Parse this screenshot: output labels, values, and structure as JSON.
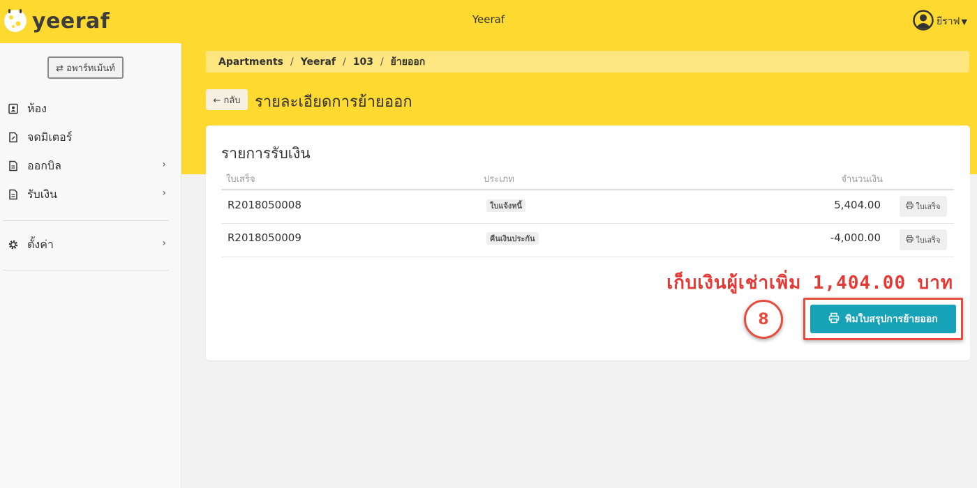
{
  "header": {
    "logo_text": "yeeraf",
    "app_title": "Yeeraf",
    "user_name": "ยีราฟ"
  },
  "sidebar": {
    "apartment_switch_label": "⇄ อพาร์ทเม้นท์",
    "items": [
      {
        "label": "ห้อง",
        "icon": "contact-card-icon",
        "has_submenu": false
      },
      {
        "label": "จดมิเตอร์",
        "icon": "edit-document-icon",
        "has_submenu": false
      },
      {
        "label": "ออกบิล",
        "icon": "document-icon",
        "has_submenu": true
      },
      {
        "label": "รับเงิน",
        "icon": "document-icon",
        "has_submenu": true
      },
      {
        "label": "ตั้งค่า",
        "icon": "gear-icon",
        "has_submenu": true
      }
    ]
  },
  "breadcrumb": [
    "Apartments",
    "Yeeraf",
    "103",
    "ย้ายออก"
  ],
  "page": {
    "back_label": "← กลับ",
    "title": "รายละเอียดการย้ายออก"
  },
  "payments": {
    "title": "รายการรับเงิน",
    "columns": {
      "receipt": "ใบเสร็จ",
      "type": "ประเภท",
      "amount": "จำนวนเงิน"
    },
    "rows": [
      {
        "receipt_no": "R2018050008",
        "type": "ใบแจ้งหนี้",
        "amount": "5,404.00",
        "button": "ใบเสร็จ"
      },
      {
        "receipt_no": "R2018050009",
        "type": "คืนเงินประกัน",
        "amount": "-4,000.00",
        "button": "ใบเสร็จ"
      }
    ],
    "extra_charge_text": "เก็บเงินผู้เช่าเพิ่ม 1,404.00 บาท",
    "step_number": "8",
    "print_summary_label": "พิมใบสรุปการย้ายออก"
  },
  "colors": {
    "brand_yellow": "#fed930",
    "accent_teal": "#17a2b8",
    "annotation_red": "#e74c3c"
  }
}
